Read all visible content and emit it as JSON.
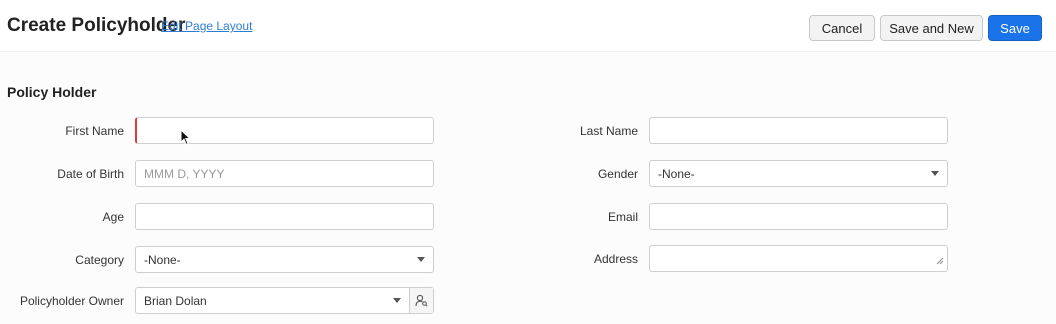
{
  "header": {
    "title": "Create Policyholder",
    "edit_layout_link": "Edit Page Layout",
    "cancel_label": "Cancel",
    "save_and_new_label": "Save and New",
    "save_label": "Save"
  },
  "section": {
    "title": "Policy Holder"
  },
  "left_fields": {
    "first_name": {
      "label": "First Name",
      "value": ""
    },
    "date_of_birth": {
      "label": "Date of Birth",
      "placeholder": "MMM D, YYYY"
    },
    "age": {
      "label": "Age",
      "value": ""
    },
    "category": {
      "label": "Category",
      "value": "-None-"
    },
    "owner": {
      "label": "Policyholder Owner",
      "value": "Brian Dolan"
    }
  },
  "right_fields": {
    "last_name": {
      "label": "Last Name",
      "value": ""
    },
    "gender": {
      "label": "Gender",
      "value": "-None-"
    },
    "email": {
      "label": "Email",
      "value": ""
    },
    "address": {
      "label": "Address",
      "value": ""
    }
  },
  "colors": {
    "primary": "#1a73e8",
    "link": "#2f7dd3",
    "required_marker": "#e03b3b"
  },
  "icons": {
    "dropdown": "chevron-down-icon",
    "lookup": "user-search-icon",
    "resize": "resize-handle-icon",
    "cursor": "mouse-pointer-icon"
  }
}
